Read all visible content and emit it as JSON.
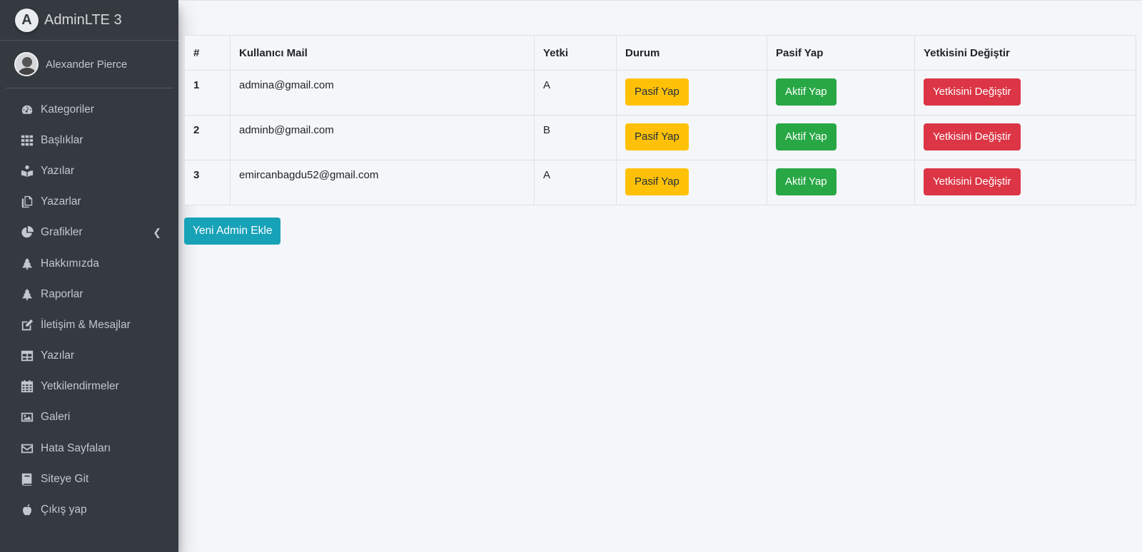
{
  "brand": {
    "title": "AdminLTE 3"
  },
  "user": {
    "name": "Alexander Pierce"
  },
  "sidebar": {
    "items": [
      {
        "label": "Kategoriler",
        "icon": "tachometer-icon"
      },
      {
        "label": "Başlıklar",
        "icon": "grid-icon"
      },
      {
        "label": "Yazılar",
        "icon": "book-reader-icon"
      },
      {
        "label": "Yazarlar",
        "icon": "copy-icon"
      },
      {
        "label": "Grafikler",
        "icon": "pie-chart-icon"
      },
      {
        "label": "Hakkımızda",
        "icon": "tree-icon"
      },
      {
        "label": "Raporlar",
        "icon": "tree-icon"
      },
      {
        "label": "İletişim & Mesajlar",
        "icon": "edit-icon"
      },
      {
        "label": "Yazılar",
        "icon": "table-icon"
      },
      {
        "label": "Yetkilendirmeler",
        "icon": "calendar-icon"
      },
      {
        "label": "Galeri",
        "icon": "image-icon"
      },
      {
        "label": "Hata Sayfaları",
        "icon": "envelope-icon"
      },
      {
        "label": "Siteye Git",
        "icon": "book-icon"
      },
      {
        "label": "Çıkış yap",
        "icon": "apple-icon"
      }
    ]
  },
  "table": {
    "headers": [
      "#",
      "Kullanıcı Mail",
      "Yetki",
      "Durum",
      "Pasif Yap",
      "Yetkisini Değiştir"
    ],
    "rows": [
      {
        "id": "1",
        "mail": "admina@gmail.com",
        "role": "A",
        "status_btn": "Pasif Yap",
        "toggle_btn": "Aktif Yap",
        "change_btn": "Yetkisini Değiştir"
      },
      {
        "id": "2",
        "mail": "adminb@gmail.com",
        "role": "B",
        "status_btn": "Pasif Yap",
        "toggle_btn": "Aktif Yap",
        "change_btn": "Yetkisini Değiştir"
      },
      {
        "id": "3",
        "mail": "emircanbagdu52@gmail.com",
        "role": "A",
        "status_btn": "Pasif Yap",
        "toggle_btn": "Aktif Yap",
        "change_btn": "Yetkisini Değiştir"
      }
    ]
  },
  "actions": {
    "add_admin": "Yeni Admin Ekle"
  },
  "colors": {
    "sidebar": "#343a40",
    "warning": "#ffc107",
    "success": "#28a745",
    "danger": "#dc3545",
    "info": "#17a2b8",
    "background": "#f4f6f9"
  }
}
